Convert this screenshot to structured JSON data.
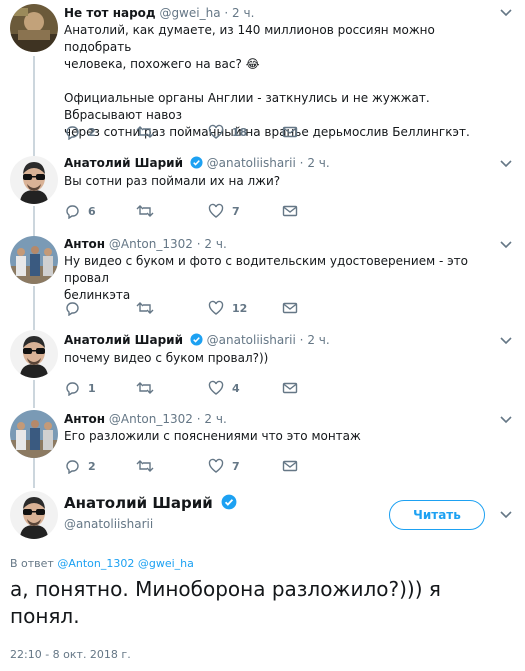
{
  "tweets": [
    {
      "name": "Не тот народ",
      "handle": "@gwei_ha",
      "dot": "·",
      "time": "2 ч.",
      "verified": false,
      "lines": [
        "Анатолий, как думаете, из 140 миллионов россиян можно подобрать",
        "человека, похожего на вас? 😂",
        "",
        "Официальные органы Англии - заткнулись и не жужжат. Вбрасывают навоз",
        "через сотни раз пойманный на вранье дерьмослив Беллингкэт."
      ],
      "replies": "2",
      "retweets": "",
      "likes": "18"
    },
    {
      "name": "Анатолий Шарий",
      "handle": "@anatoliisharii",
      "dot": "·",
      "time": "2 ч.",
      "verified": true,
      "lines": [
        "Вы сотни раз поймали их на лжи?"
      ],
      "replies": "6",
      "retweets": "",
      "likes": "7"
    },
    {
      "name": "Антон",
      "handle": "@Anton_1302",
      "dot": "·",
      "time": "2 ч.",
      "verified": false,
      "lines": [
        "Ну видео с буком и фото с водительским удостоверением - это провал",
        "белинкэта"
      ],
      "replies": "",
      "retweets": "",
      "likes": "12"
    },
    {
      "name": "Анатолий Шарий",
      "handle": "@anatoliisharii",
      "dot": "·",
      "time": "2 ч.",
      "verified": true,
      "lines": [
        "почему видео с буком провал?))"
      ],
      "replies": "1",
      "retweets": "",
      "likes": "4"
    },
    {
      "name": "Антон",
      "handle": "@Anton_1302",
      "dot": "·",
      "time": "2 ч.",
      "verified": false,
      "lines": [
        "Его разложили с пояснениями что это монтаж"
      ],
      "replies": "2",
      "retweets": "",
      "likes": "7"
    }
  ],
  "main": {
    "name": "Анатолий Шарий",
    "handle": "@anatoliisharii",
    "follow_label": "Читать",
    "reply_prefix": "В ответ",
    "reply_users": [
      "@Anton_1302",
      "@gwei_ha"
    ],
    "text_line1": "а, понятно. Миноборона разложило?))) я",
    "text_line2": "понял.",
    "date": "22:10 - 8 окт. 2018 г."
  },
  "icons": {
    "reply": "reply-icon",
    "retweet": "retweet-icon",
    "like": "heart-icon",
    "dm": "envelope-icon",
    "verified": "verified-badge-icon",
    "caret": "chevron-down-icon"
  },
  "colors": {
    "text": "#14171a",
    "secondary": "#657786",
    "accent": "#1da1f2",
    "line": "#ccd6dd"
  }
}
